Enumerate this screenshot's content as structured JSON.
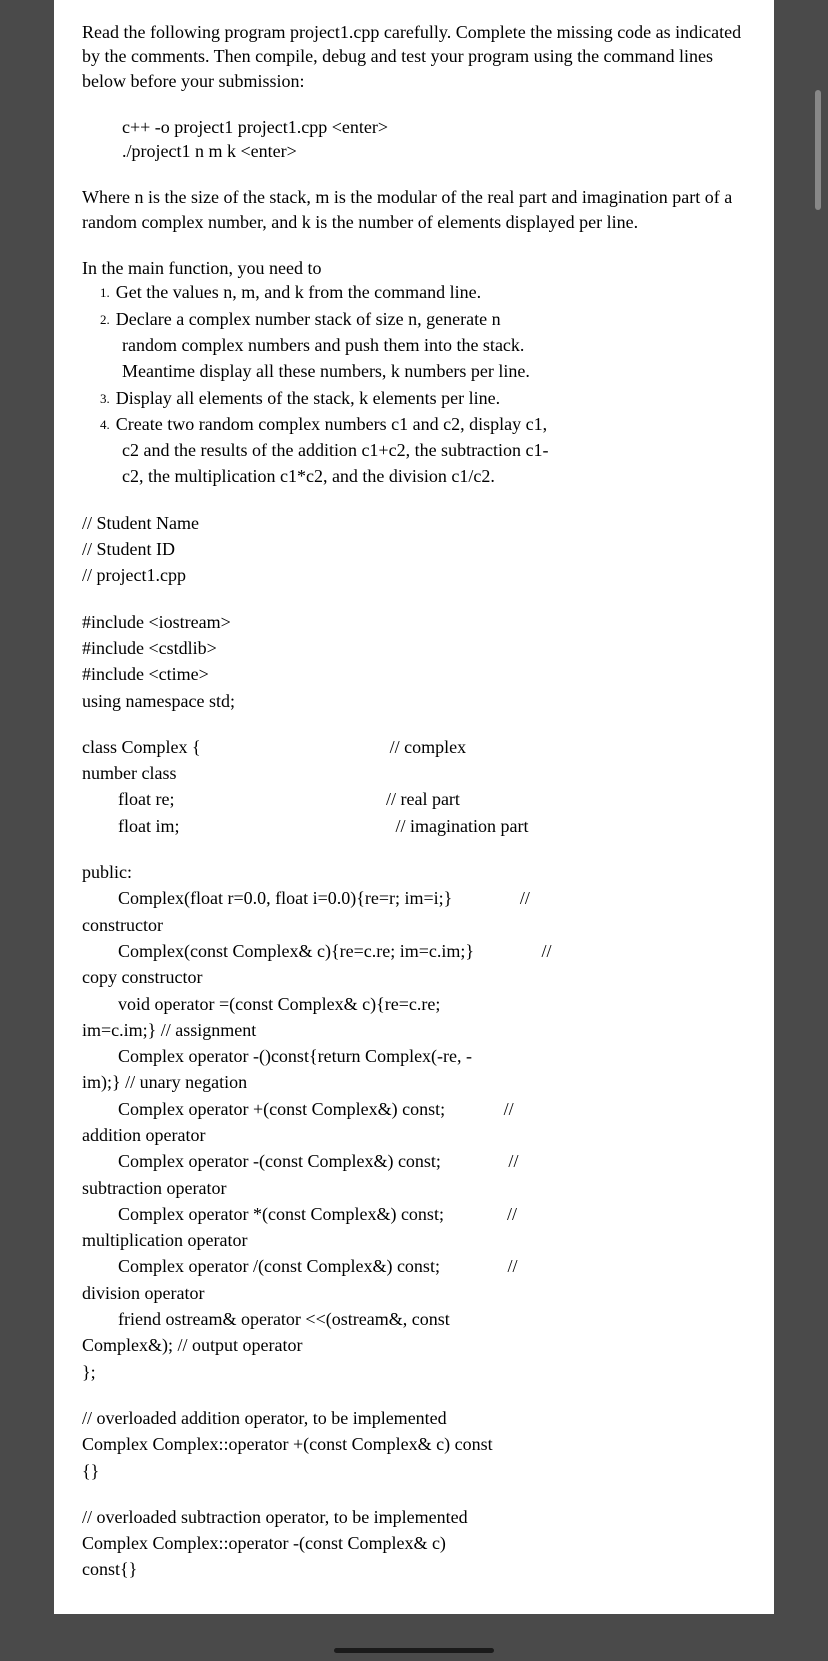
{
  "intro": "Read the following program project1.cpp carefully. Complete the missing code as indicated by the comments. Then compile, debug and test your program using the command lines below before your submission:",
  "cmd1": "c++ -o project1 project1.cpp <enter>",
  "cmd2": "./project1 n m k <enter>",
  "where": "Where n is the size of the stack, m is the modular of the real part and imagination part of a random complex number, and k is the number of elements displayed per line.",
  "main_intro": "In the main function, you need to",
  "li1_num": "1.",
  "li1": "Get the values n, m, and k from the command line.",
  "li2_num": "2.",
  "li2a": "Declare a complex number stack of size n, generate n",
  "li2b": "random complex numbers and push them into the stack.",
  "li2c": "Meantime display all these numbers, k numbers per line.",
  "li3_num": "3.",
  "li3": "Display all elements of the stack, k elements per line.",
  "li4_num": "4.",
  "li4a": "Create two random complex numbers c1 and c2, display c1,",
  "li4b": "c2 and the results of the addition c1+c2, the subtraction c1-",
  "li4c": "c2, the multiplication c1*c2, and the division c1/c2.",
  "c_name": "// Student Name",
  "c_id": "// Student ID",
  "c_file": "// project1.cpp",
  "inc1": "#include <iostream>",
  "inc2": "#include <cstdlib>",
  "inc3": "#include <ctime>",
  "using": "using namespace std;",
  "class1": "class Complex {                                          // complex",
  "class2": "number class",
  "class3": "float re;                                               // real part",
  "class4": "float im;                                                // imagination part",
  "pub": "public:",
  "pub1": "Complex(float r=0.0, float i=0.0){re=r; im=i;}               //",
  "pub1b": "constructor",
  "pub2": "Complex(const Complex& c){re=c.re; im=c.im;}               //",
  "pub2b": "copy constructor",
  "pub3": "void operator =(const Complex& c){re=c.re;",
  "pub3b": "im=c.im;}       // assignment",
  "pub4": "Complex operator -()const{return Complex(-re, -",
  "pub4b": "im);}               // unary negation",
  "pub5": "Complex operator +(const Complex&) const;             //",
  "pub5b": "addition operator",
  "pub6": "Complex operator -(const Complex&) const;               //",
  "pub6b": "subtraction operator",
  "pub7": "Complex operator *(const Complex&) const;              //",
  "pub7b": "multiplication operator",
  "pub8": "Complex operator /(const Complex&) const;               //",
  "pub8b": "division operator",
  "pub9": "friend ostream& operator <<(ostream&, const",
  "pub9b": "Complex&);   // output operator",
  "pub10": "};",
  "ov_add1": "// overloaded addition operator, to be implemented",
  "ov_add2": "Complex Complex::operator +(const Complex& c) const",
  "ov_add3": "{}",
  "ov_sub1": "// overloaded subtraction operator, to be implemented",
  "ov_sub2": "Complex Complex::operator -(const Complex& c)",
  "ov_sub3": "const{}"
}
